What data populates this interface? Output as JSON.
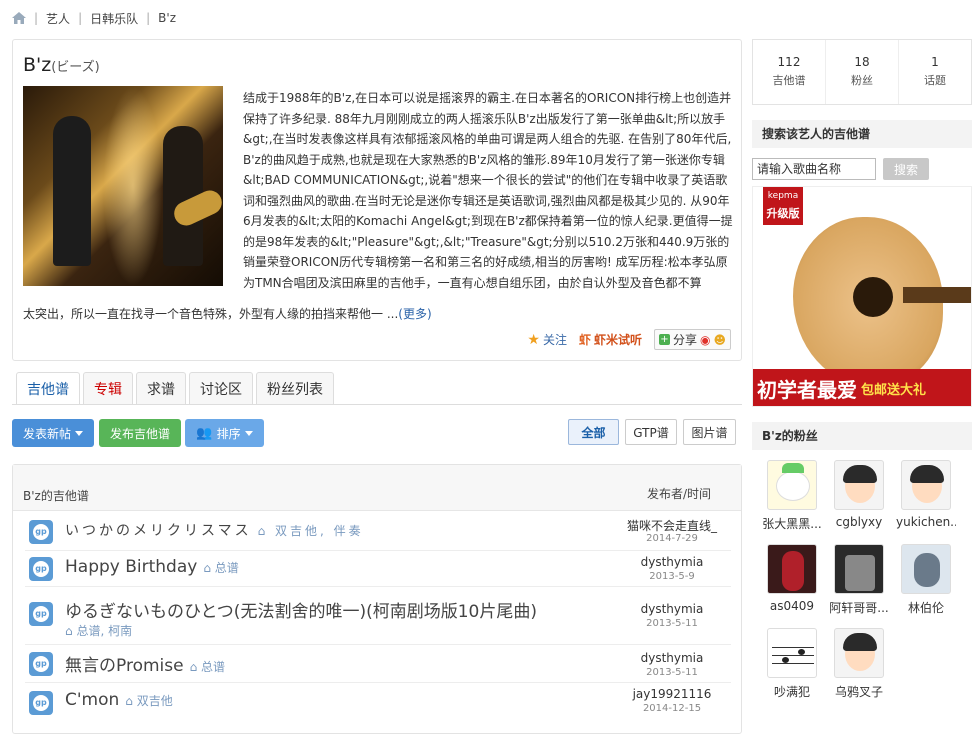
{
  "breadcrumb": {
    "items": [
      "艺人",
      "日韩乐队",
      "B'z"
    ]
  },
  "artist": {
    "name": "B'z",
    "alias": "(ビーズ)",
    "bio": "结成于1988年的B'z,在日本可以说是摇滚界的霸主.在日本著名的ORICON排行榜上也创造并保持了许多纪录. 88年九月刚刚成立的两人摇滚乐队B'z出版发行了第一张单曲&lt;所以放手&gt;,在当时发表像这样具有浓郁摇滚风格的单曲可谓是两人组合的先驱. 在告别了80年代后,B'z的曲风趋于成熟,也就是现在大家熟悉的B'z风格的雏形.89年10月发行了第一张迷你专辑&lt;BAD COMMUNICATION&gt;,说着\"想来一个很长的尝试\"的他们在专辑中收录了英语歌词和强烈曲风的歌曲.在当时无论是迷你专辑还是英语歌词,强烈曲风都是极其少见的. 从90年6月发表的&lt;太阳的Komachi Angel&gt;到现在B'z都保持着第一位的惊人纪录.更值得一提的是98年发表的&lt;\"Pleasure\"&gt;,&lt;\"Treasure\"&gt;分别以510.2万张和440.9万张的销量荣登ORICON历代专辑榜第一名和第三名的好成绩,相当的厉害哟! 成军历程:松本孝弘原为TMN合唱团及滨田麻里的吉他手，一直有心想自组乐团，由於自认外型及音色都不算",
    "bio_tail": "太突出，所以一直在找寻一个音色特殊，外型有人缘的拍挡来帮他一 ...",
    "more": "(更多)",
    "follow": "关注",
    "xiami": "虾米试听",
    "share": "分享"
  },
  "tabs": [
    {
      "label": "吉他谱"
    },
    {
      "label": "专辑"
    },
    {
      "label": "求谱"
    },
    {
      "label": "讨论区"
    },
    {
      "label": "粉丝列表"
    }
  ],
  "toolbar": {
    "post": "发表新帖",
    "publish": "发布吉他谱",
    "sort": "排序",
    "filter_all": "全部",
    "filter_gtp": "GTP谱",
    "filter_img": "图片谱"
  },
  "list": {
    "title": "B'z的吉他谱",
    "author_col": "发布者/时间",
    "rows": [
      {
        "name": "いつかのメリクリスマス",
        "tags": "双吉他, 伴奏",
        "author": "猫咪不会走直线_",
        "date": "2014-7-29"
      },
      {
        "name": "Happy Birthday",
        "tags": "总谱",
        "author": "dysthymia",
        "date": "2013-5-9"
      },
      {
        "name": "ゆるぎないものひとつ(无法割舍的唯一)(柯南剧场版10片尾曲)",
        "tags": "总谱, 柯南",
        "author": "dysthymia",
        "date": "2013-5-11"
      },
      {
        "name": "無言のPromise",
        "tags": "总谱",
        "author": "dysthymia",
        "date": "2013-5-11"
      },
      {
        "name": "C'mon",
        "tags": "双吉他",
        "author": "jay19921116",
        "date": "2014-12-15"
      }
    ]
  },
  "stats": [
    {
      "num": "112",
      "label": "吉他谱"
    },
    {
      "num": "18",
      "label": "粉丝"
    },
    {
      "num": "1",
      "label": "话题"
    }
  ],
  "search": {
    "title": "搜索该艺人的吉他谱",
    "placeholder": "请输入歌曲名称",
    "button": "搜索"
  },
  "ad": {
    "brand": "kepma",
    "brand_sub": "升级版",
    "slogan": "初学者最爱",
    "slogan_sub": "包邮送大礼"
  },
  "fans": {
    "title": "B'z的粉丝",
    "items": [
      "张大黑黑...",
      "cgblyxy",
      "yukichen...",
      "as0409",
      "阿轩哥哥...",
      "林伯伦",
      "吵满犯",
      "乌鸦叉子"
    ]
  },
  "colors": {
    "link": "#1a5fa8",
    "accent_red": "#c0151a",
    "btn_blue": "#4a8fd8",
    "btn_green": "#58b558"
  }
}
